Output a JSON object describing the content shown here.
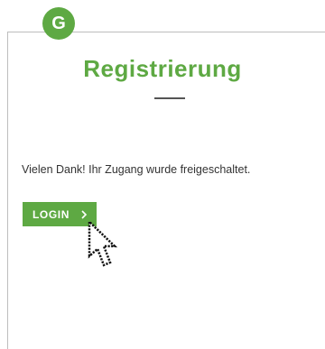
{
  "logo": {
    "letter": "G",
    "icon": "logo-g-badge"
  },
  "page": {
    "title": "Registrierung",
    "message": "Vielen Dank! Ihr Zugang wurde freigeschaltet."
  },
  "login_button": {
    "label": "LOGIN",
    "icon": "chevron-right-icon"
  },
  "cursor": {
    "icon": "mouse-pointer-icon"
  },
  "colors": {
    "brand_green": "#5ea943",
    "text": "#333333",
    "divider": "#555555",
    "panel_border": "#bdbdbd",
    "background": "#ffffff"
  }
}
